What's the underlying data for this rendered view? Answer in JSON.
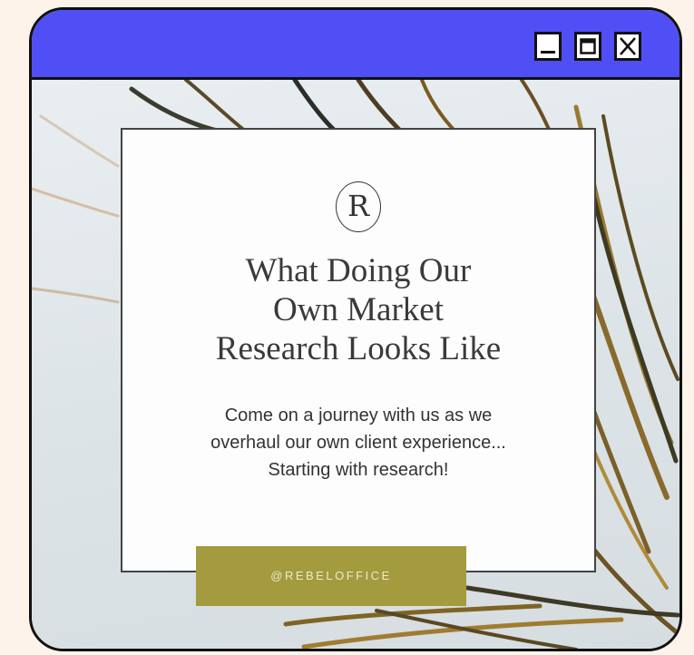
{
  "window": {
    "titlebar_color": "#4f4ff5",
    "controls": [
      {
        "name": "minimize",
        "icon": "minimize-icon"
      },
      {
        "name": "maximize",
        "icon": "maximize-icon"
      },
      {
        "name": "close",
        "icon": "close-icon"
      }
    ]
  },
  "card": {
    "logo_letter": "R",
    "headline_lines": [
      "What Doing Our",
      "Own Market",
      "Research Looks Like"
    ],
    "subtitle_lines": [
      "Come on a journey with us as we",
      "overhaul our own client experience...",
      "Starting with research!"
    ]
  },
  "handle_button": {
    "label": "@REBELOFFICE",
    "color": "#a49b3f"
  }
}
